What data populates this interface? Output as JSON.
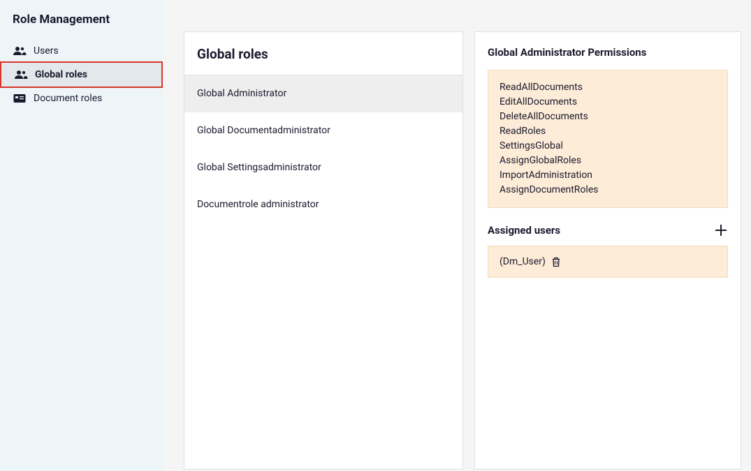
{
  "sidebar": {
    "title": "Role Management",
    "items": [
      {
        "label": "Users"
      },
      {
        "label": "Global roles"
      },
      {
        "label": "Document roles"
      }
    ]
  },
  "rolesPanel": {
    "title": "Global roles",
    "items": [
      {
        "label": "Global Administrator"
      },
      {
        "label": "Global Documentadministrator"
      },
      {
        "label": "Global Settingsadministrator"
      },
      {
        "label": "Documentrole administrator"
      }
    ]
  },
  "details": {
    "permissionsTitle": "Global Administrator Permissions",
    "permissions": [
      "ReadAllDocuments",
      "EditAllDocuments",
      "DeleteAllDocuments",
      "ReadRoles",
      "SettingsGlobal",
      "AssignGlobalRoles",
      "ImportAdministration",
      "AssignDocumentRoles"
    ],
    "assignedUsersTitle": "Assigned users",
    "assignedUsers": [
      {
        "name": "(Dm_User)"
      }
    ]
  }
}
